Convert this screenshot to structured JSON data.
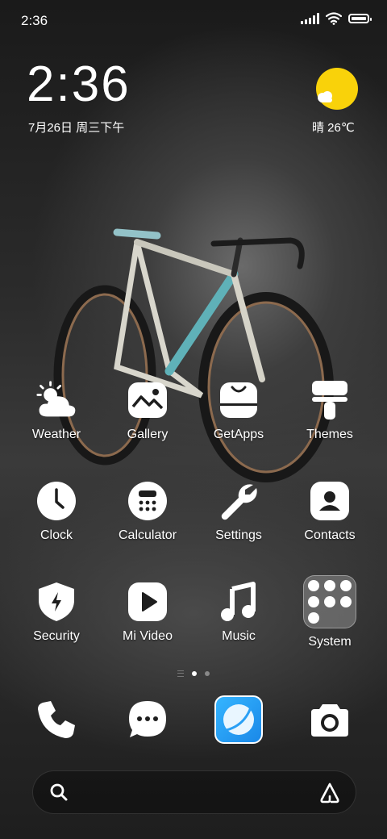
{
  "status_bar": {
    "time": "2:36"
  },
  "clock_widget": {
    "time": "2:36",
    "date": "7月26日 周三下午"
  },
  "weather_widget": {
    "text": "晴 26℃",
    "sun_color": "#f9d20a"
  },
  "apps": {
    "row1": [
      "Weather",
      "Gallery",
      "GetApps",
      "Themes"
    ],
    "row2": [
      "Clock",
      "Calculator",
      "Settings",
      "Contacts"
    ],
    "row3": [
      "Security",
      "Mi Video",
      "Music",
      "System"
    ]
  },
  "page_indicator": {
    "pages": 2,
    "current": 1
  },
  "dock": {
    "apps": [
      "phone-icon",
      "messaging-icon",
      "browser-icon",
      "camera-icon"
    ]
  },
  "search": {
    "placeholder": ""
  },
  "colors": {
    "accent": "#f9d20a",
    "browser": "#2aa0f5"
  }
}
